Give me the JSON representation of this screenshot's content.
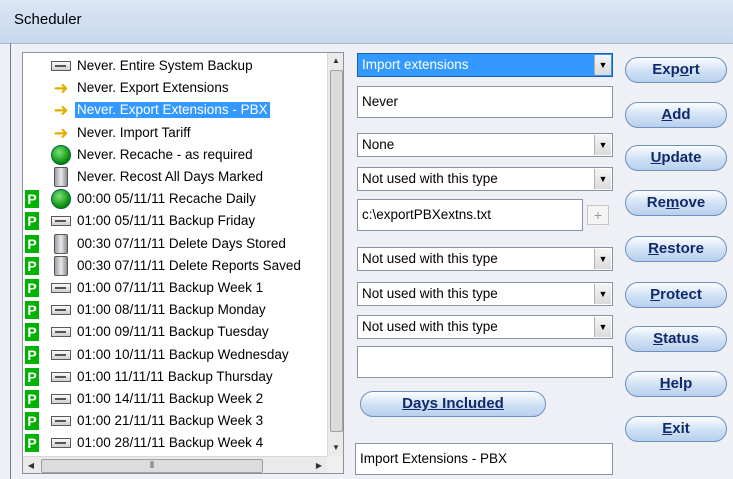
{
  "window": {
    "title": "Scheduler"
  },
  "schedule_list": {
    "items": [
      {
        "prefix": "",
        "icon": "drive-icon",
        "label": "Never.  Entire System Backup"
      },
      {
        "prefix": "",
        "icon": "export-icon",
        "label": "Never.  Export Extensions"
      },
      {
        "prefix": "",
        "icon": "export-icon",
        "label": "Never.  Export Extensions - PBX",
        "selected": true
      },
      {
        "prefix": "",
        "icon": "import-icon",
        "label": "Never.  Import Tariff"
      },
      {
        "prefix": "",
        "icon": "globe-icon",
        "label": "Never.  Recache - as required"
      },
      {
        "prefix": "",
        "icon": "recycle-bin-icon",
        "label": "Never.  Recost All Days Marked"
      },
      {
        "prefix": "P",
        "icon": "globe-icon",
        "label": "00:00 05/11/11 Recache Daily"
      },
      {
        "prefix": "P",
        "icon": "drive-icon",
        "label": "01:00 05/11/11 Backup Friday"
      },
      {
        "prefix": "P",
        "icon": "recycle-bin-icon",
        "label": "00:30 07/11/11 Delete Days Stored"
      },
      {
        "prefix": "P",
        "icon": "recycle-bin-icon",
        "label": "00:30 07/11/11 Delete Reports Saved"
      },
      {
        "prefix": "P",
        "icon": "drive-icon",
        "label": "01:00 07/11/11 Backup Week 1"
      },
      {
        "prefix": "P",
        "icon": "drive-icon",
        "label": "01:00 08/11/11 Backup Monday"
      },
      {
        "prefix": "P",
        "icon": "drive-icon",
        "label": "01:00 09/11/11 Backup Tuesday"
      },
      {
        "prefix": "P",
        "icon": "drive-icon",
        "label": "01:00 10/11/11 Backup Wednesday"
      },
      {
        "prefix": "P",
        "icon": "drive-icon",
        "label": "01:00 11/11/11 Backup Thursday"
      },
      {
        "prefix": "P",
        "icon": "drive-icon",
        "label": "01:00 14/11/11 Backup Week 2"
      },
      {
        "prefix": "P",
        "icon": "drive-icon",
        "label": "01:00 21/11/11 Backup Week 3"
      },
      {
        "prefix": "P",
        "icon": "drive-icon",
        "label": "01:00 28/11/11 Backup Week 4"
      }
    ]
  },
  "form": {
    "task_type": "Import extensions",
    "frequency": "Never",
    "option1": "None",
    "option2": "Not used with this type",
    "file_path": "c:\\exportPBXextns.txt",
    "option3": "Not used with this type",
    "option4": "Not used with this type",
    "option5": "Not used with this type",
    "blank_field": "",
    "days_included_label": "Days Included",
    "description": "Import Extensions - PBX",
    "plus_label": "+"
  },
  "buttons": {
    "export": {
      "pre": "Exp",
      "u": "o",
      "post": "rt"
    },
    "add": {
      "pre": "",
      "u": "A",
      "post": "dd"
    },
    "update": {
      "pre": "",
      "u": "U",
      "post": "pdate"
    },
    "remove": {
      "pre": "Re",
      "u": "m",
      "post": "ove"
    },
    "restore": {
      "pre": "",
      "u": "R",
      "post": "estore"
    },
    "protect": {
      "pre": "",
      "u": "P",
      "post": "rotect"
    },
    "status": {
      "pre": "",
      "u": "S",
      "post": "tatus"
    },
    "help": {
      "pre": "",
      "u": "H",
      "post": "elp"
    },
    "exit": {
      "pre": "",
      "u": "E",
      "post": "xit"
    }
  },
  "colors": {
    "accent": "#3399ff",
    "p_badge": "#00b300",
    "button_text": "#102a6b"
  }
}
